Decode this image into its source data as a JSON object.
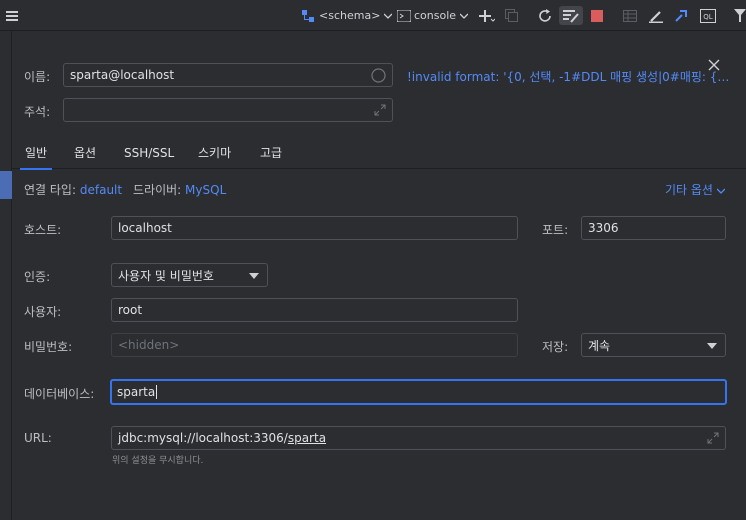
{
  "toolbar": {
    "schema_label": "<schema>",
    "console_label": "console"
  },
  "dialog": {
    "name_label": "이름:",
    "name_value": "sparta@localhost",
    "comment_label": "주석:",
    "warning_text": "!invalid format: '{0, 선택, -1#DDL 매핑 생성|0#매핑: {1}|0...",
    "tabs": [
      "일반",
      "옵션",
      "SSH/SSL",
      "스키마",
      "고급"
    ],
    "conn_type_label": "연결 타입:",
    "conn_type_value": "default",
    "driver_label": "드라이버:",
    "driver_value": "MySQL",
    "other_options": "기타 옵션",
    "host_label": "호스트:",
    "host_value": "localhost",
    "port_label": "포트:",
    "port_value": "3306",
    "auth_label": "인증:",
    "auth_value": "사용자 및 비밀번호",
    "user_label": "사용자:",
    "user_value": "root",
    "password_label": "비밀번호:",
    "password_placeholder": "<hidden>",
    "save_label": "저장:",
    "save_value": "계속",
    "database_label": "데이터베이스:",
    "database_value": "sparta",
    "url_label": "URL:",
    "url_prefix": "jdbc:mysql://localhost:3306/",
    "url_db": "sparta",
    "url_hint": "위의 설정을 무시합니다."
  },
  "colors": {
    "background": "#2b2d30",
    "accent": "#3574f0",
    "link": "#548af7",
    "stop": "#db5c5c"
  },
  "icons": [
    "list-icon",
    "database-schema-icon",
    "console-icon",
    "add-icon",
    "copy-icon",
    "refresh-icon",
    "edit-table-icon",
    "stop-icon",
    "table-icon",
    "edit-icon",
    "jump-icon",
    "sql-icon",
    "filter-icon",
    "close-icon",
    "expand-icon",
    "circle-icon"
  ]
}
